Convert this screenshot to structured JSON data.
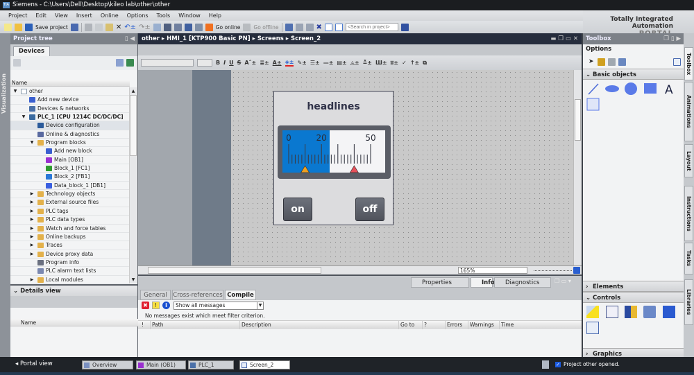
{
  "window": {
    "title": "Siemens  -  C:\\Users\\Dell\\Desktop\\kileo lab\\other\\other"
  },
  "brand": {
    "line1": "Totally Integrated Automation",
    "line2": "PORTAL"
  },
  "menu": [
    "Project",
    "Edit",
    "View",
    "Insert",
    "Online",
    "Options",
    "Tools",
    "Window",
    "Help"
  ],
  "toolbar": {
    "save_project": "Save project",
    "go_online": "Go online",
    "go_offline": "Go offline",
    "search_placeholder": "<Search in project>"
  },
  "left_strip": {
    "label": "Visualization"
  },
  "project_tree": {
    "title": "Project tree",
    "tab": "Devices",
    "name_header": "Name",
    "items": [
      {
        "label": "other",
        "level": 0,
        "expander": "open",
        "icon": "project",
        "color": "#ffffff"
      },
      {
        "label": "Add new device",
        "level": 1,
        "expander": "",
        "icon": "add-device",
        "color": "#3a5fd0"
      },
      {
        "label": "Devices & networks",
        "level": 1,
        "expander": "",
        "icon": "network",
        "color": "#4a70a8"
      },
      {
        "label": "PLC_1 [CPU 1214C DC/DC/DC]",
        "level": 1,
        "expander": "open",
        "icon": "plc",
        "color": "#3a6aa0",
        "bold": true
      },
      {
        "label": "Device configuration",
        "level": 2,
        "expander": "",
        "icon": "device-config",
        "color": "#2a5a9a",
        "selected": true
      },
      {
        "label": "Online & diagnostics",
        "level": 2,
        "expander": "",
        "icon": "diagnostics",
        "color": "#5a6aa0"
      },
      {
        "label": "Program blocks",
        "level": 2,
        "expander": "open",
        "icon": "folder",
        "color": "#e3b14b"
      },
      {
        "label": "Add new block",
        "level": 3,
        "expander": "",
        "icon": "add-block",
        "color": "#3a5fd0"
      },
      {
        "label": "Main [OB1]",
        "level": 3,
        "expander": "",
        "icon": "ob-block",
        "color": "#9a2fd0"
      },
      {
        "label": "Block_1 [FC1]",
        "level": 3,
        "expander": "",
        "icon": "fc-block",
        "color": "#2e9a2e"
      },
      {
        "label": "Block_2 [FB1]",
        "level": 3,
        "expander": "",
        "icon": "fb-block",
        "color": "#2a78d8"
      },
      {
        "label": "Data_block_1 [DB1]",
        "level": 3,
        "expander": "",
        "icon": "db-block",
        "color": "#3a5fe0"
      },
      {
        "label": "Technology objects",
        "level": 2,
        "expander": "closed",
        "icon": "folder",
        "color": "#e3b14b"
      },
      {
        "label": "External source files",
        "level": 2,
        "expander": "closed",
        "icon": "folder",
        "color": "#e3b14b"
      },
      {
        "label": "PLC tags",
        "level": 2,
        "expander": "closed",
        "icon": "folder",
        "color": "#e3b14b"
      },
      {
        "label": "PLC data types",
        "level": 2,
        "expander": "closed",
        "icon": "folder",
        "color": "#e3b14b"
      },
      {
        "label": "Watch and force tables",
        "level": 2,
        "expander": "closed",
        "icon": "folder",
        "color": "#e3b14b"
      },
      {
        "label": "Online backups",
        "level": 2,
        "expander": "closed",
        "icon": "folder",
        "color": "#e3b14b"
      },
      {
        "label": "Traces",
        "level": 2,
        "expander": "closed",
        "icon": "folder",
        "color": "#e3b14b"
      },
      {
        "label": "Device proxy data",
        "level": 2,
        "expander": "closed",
        "icon": "folder",
        "color": "#e3b14b"
      },
      {
        "label": "Program info",
        "level": 2,
        "expander": "",
        "icon": "program-info",
        "color": "#6a7080"
      },
      {
        "label": "PLC alarm text lists",
        "level": 2,
        "expander": "",
        "icon": "alarm-text",
        "color": "#7a88b0"
      },
      {
        "label": "Local modules",
        "level": 2,
        "expander": "closed",
        "icon": "folder",
        "color": "#e3b14b"
      }
    ]
  },
  "details_view": {
    "title": "Details view",
    "name_header": "Name"
  },
  "breadcrumb": [
    "other",
    "HMI_1 [KTP900 Basic PN]",
    "Screens",
    "Screen_2"
  ],
  "editor": {
    "zoom": "165%"
  },
  "hmi_screen": {
    "title": "headlines",
    "gauge": {
      "min": 0,
      "max": 50,
      "value": 25,
      "tick_labels": [
        "0",
        "20",
        "50"
      ],
      "tick_label_values": [
        0,
        20,
        50
      ],
      "marker_low": 10,
      "marker_high": 40,
      "fill_color": "#0a78d0",
      "marker_low_color": "#f0a020",
      "marker_high_color": "#e8505a"
    },
    "buttons": {
      "on": "on",
      "off": "off"
    }
  },
  "inspector": {
    "tabs": [
      "Properties",
      "Info",
      "Diagnostics"
    ],
    "active_tab": "Info",
    "subtabs": [
      "General",
      "Cross-references",
      "Compile"
    ],
    "active_subtab": "Compile",
    "filter": "Show all messages",
    "message": "No messages exist which meet filter criterion.",
    "columns": [
      "!",
      "Path",
      "Description",
      "Go to",
      "?",
      "Errors",
      "Warnings",
      "Time"
    ]
  },
  "toolbox": {
    "title": "Toolbox",
    "options": "Options",
    "sections": {
      "basic": "Basic objects",
      "elements": "Elements",
      "controls": "Controls",
      "graphics": "Graphics"
    },
    "text_tool_glyph": "A"
  },
  "side_tabs": [
    "Toolbox",
    "Animations",
    "Layout",
    "Instructions",
    "Tasks",
    "Libraries"
  ],
  "statusbar": {
    "portal_view": "Portal view",
    "tasks": [
      "Overview",
      "Main (OB1)",
      "PLC_1",
      "Screen_2"
    ],
    "active_task": "Screen_2",
    "status": "Project other opened."
  }
}
